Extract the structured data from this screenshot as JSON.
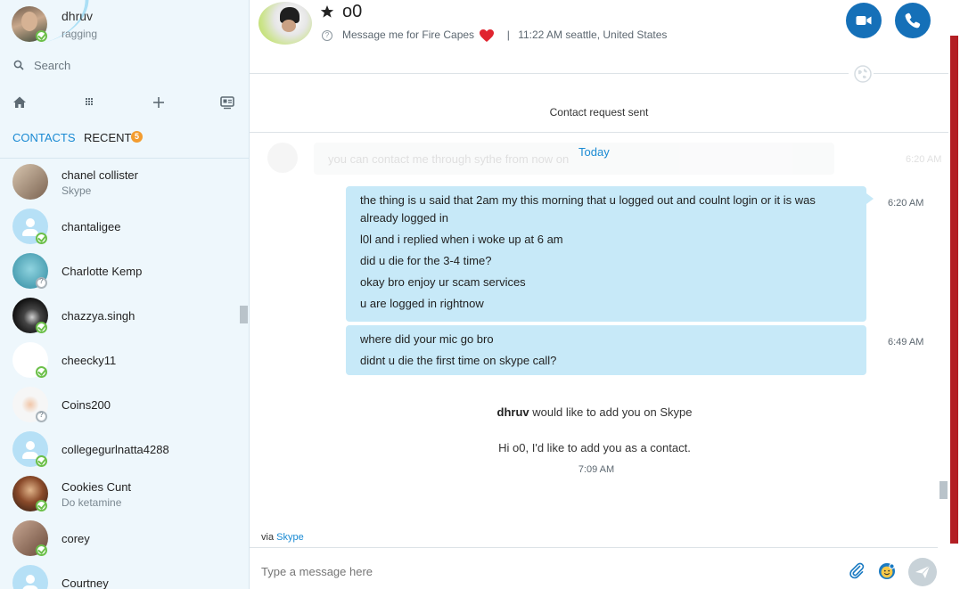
{
  "me": {
    "name": "dhruv",
    "status": "ragging"
  },
  "search": {
    "label": "Search"
  },
  "tabs": {
    "contacts": "CONTACTS",
    "recent": "RECENT",
    "recent_count": "5"
  },
  "contacts": [
    {
      "name": "chanel collister",
      "sub": "Skype",
      "presence": "none",
      "avatar_color": "#a08870"
    },
    {
      "name": "chantaligee",
      "sub": "",
      "presence": "online",
      "avatar_color": "default"
    },
    {
      "name": "Charlotte Kemp",
      "sub": "",
      "presence": "unknown",
      "avatar_color": "#4fa6b8"
    },
    {
      "name": "chazzya.singh",
      "sub": "",
      "presence": "online",
      "avatar_color": "#222222"
    },
    {
      "name": "cheecky11",
      "sub": "",
      "presence": "online",
      "avatar_color": "#ffffff"
    },
    {
      "name": "Coins200",
      "sub": "",
      "presence": "unknown",
      "avatar_color": "#f4f4f4"
    },
    {
      "name": "collegegurlnatta4288",
      "sub": "",
      "presence": "online",
      "avatar_color": "default"
    },
    {
      "name": "Cookies Cunt",
      "sub": "Do ketamine",
      "presence": "online",
      "avatar_color": "#6a3a22"
    },
    {
      "name": "corey",
      "sub": "",
      "presence": "online",
      "avatar_color": "#9a7a66"
    },
    {
      "name": "Courtney",
      "sub": "",
      "presence": "none",
      "avatar_color": "default"
    }
  ],
  "chat": {
    "title": "o0",
    "mood": "Message me for Fire Capes",
    "local_time": "11:22 AM seattle, United States",
    "request_sent": "Contact request sent",
    "faded_message": "you can contact me through sythe from now on",
    "faded_time": "6:20 AM",
    "day_label": "Today",
    "groups": [
      {
        "time": "6:20 AM",
        "messages": [
          "the thing is u said that 2am my this morning that u logged out and coulnt login or it is was already logged in",
          "l0l and i replied when i woke up at 6 am",
          "did u die for the 3-4 time?",
          "okay bro enjoy ur scam services",
          "u are logged in rightnow"
        ]
      },
      {
        "time": "6:49 AM",
        "messages": [
          "where did your mic go bro",
          "didnt u die the first time on skype call?"
        ]
      }
    ],
    "add_request_name": "dhruv",
    "add_request_text": "would like to add you on Skype",
    "add_greeting": "Hi o0, I'd like to add you as a contact.",
    "add_time": "7:09 AM",
    "via_label": "via",
    "via_link": "Skype",
    "compose_placeholder": "Type a message here"
  },
  "colors": {
    "accent": "#1a8ad3",
    "call_button": "#1570b8",
    "bubble": "#c7e9f8",
    "badge": "#f39c2f",
    "online": "#6cc04a"
  }
}
